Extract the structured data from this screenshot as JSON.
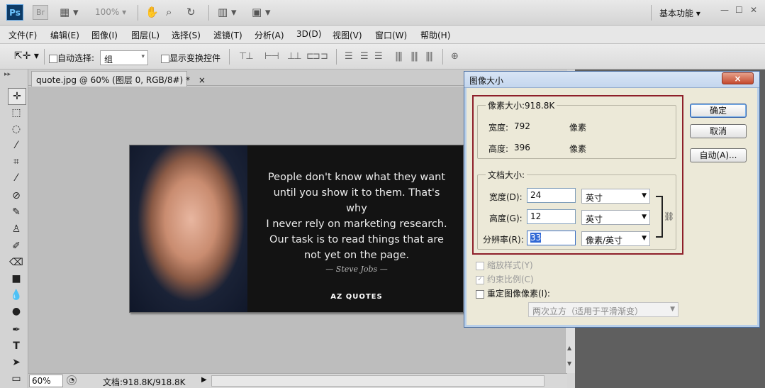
{
  "appbar": {
    "ps_logo": "Ps",
    "br_logo": "Br",
    "zoom": "100%",
    "workspace": "基本功能"
  },
  "menu": [
    "文件(F)",
    "编辑(E)",
    "图像(I)",
    "图层(L)",
    "选择(S)",
    "滤镜(T)",
    "分析(A)",
    "3D(D)",
    "视图(V)",
    "窗口(W)",
    "帮助(H)"
  ],
  "options": {
    "auto_select_label": "自动选择:",
    "auto_select_value": "组",
    "show_transform_label": "显示变换控件"
  },
  "document": {
    "tab_title": "quote.jpg @ 60% (图层 0, RGB/8#) *",
    "tab_close": "×",
    "zoom": "60%",
    "doc_info": "文档:918.8K/918.8K",
    "image": {
      "quote_lines": [
        "People don't know what they want",
        "until you show it to them. That's why",
        "I never rely on marketing research.",
        "Our task is to read things that are",
        "not yet on the page."
      ],
      "signature": "— Steve Jobs —",
      "brand": "AZ QUOTES"
    }
  },
  "dialog": {
    "title": "图像大小",
    "close": "×",
    "pixel_dims": {
      "legend": "像素大小:918.8K",
      "width_label": "宽度:",
      "width_value": "792",
      "width_unit": "像素",
      "height_label": "高度:",
      "height_value": "396",
      "height_unit": "像素"
    },
    "doc_size": {
      "legend": "文档大小:",
      "width_label": "宽度(D):",
      "width_value": "24",
      "width_unit": "英寸",
      "height_label": "高度(G):",
      "height_value": "12",
      "height_unit": "英寸",
      "res_label": "分辨率(R):",
      "res_value": "33",
      "res_unit": "像素/英寸"
    },
    "scale_styles": "缩放样式(Y)",
    "constrain": "约束比例(C)",
    "resample": "重定图像像素(I):",
    "resample_method": "两次立方（适用于平滑渐变）",
    "ok": "确定",
    "cancel": "取消",
    "auto": "自动(A)..."
  },
  "colors": {
    "accent_box": "#8e1f2a",
    "ps_blue": "#0d3b66"
  }
}
